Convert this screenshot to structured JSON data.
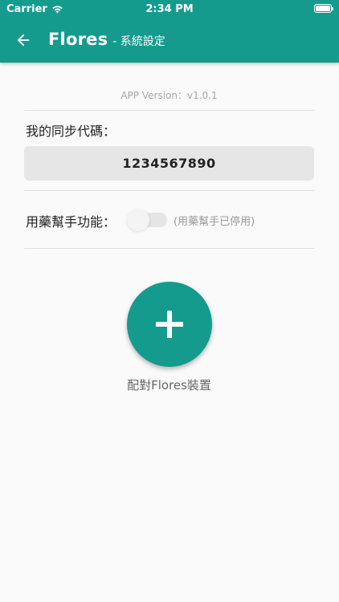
{
  "status_bar": {
    "carrier": "Carrier",
    "time": "2:34 PM",
    "battery_level": 1.0
  },
  "app_bar": {
    "title": "Flores",
    "subtitle": "- 系統設定",
    "back_icon": "arrow-left-icon"
  },
  "settings": {
    "version_text": "APP Version：v1.0.1",
    "sync_label": "我的同步代碼：",
    "sync_code": "1234567890",
    "helper_label": "用藥幫手功能：",
    "helper_enabled": false,
    "helper_status": "(用藥幫手已停用)"
  },
  "pair_device": {
    "icon": "plus-icon",
    "label": "配對Flores裝置"
  },
  "colors": {
    "primary": "#149b8d",
    "background": "#fafafa",
    "code_box": "#e6e6e6"
  }
}
